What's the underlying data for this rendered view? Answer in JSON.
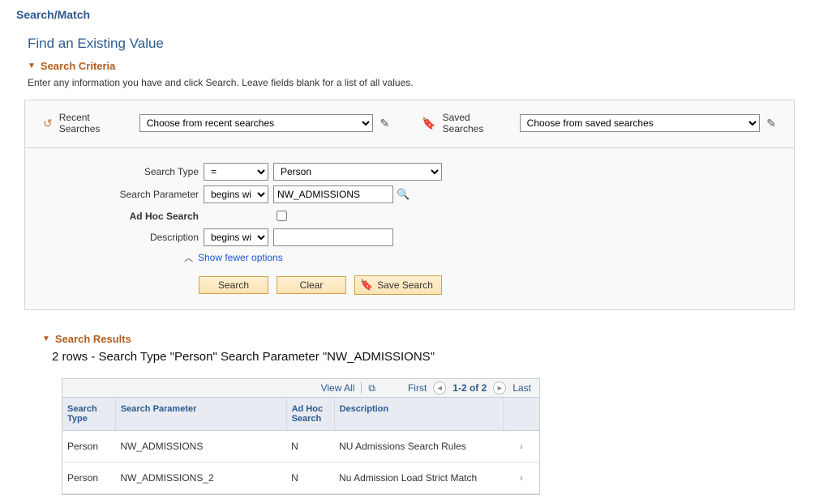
{
  "page_title": "Search/Match",
  "find_title": "Find an Existing Value",
  "criteria_label": "Search Criteria",
  "instructions": "Enter any information you have and click Search. Leave fields blank for a list of all values.",
  "recent": {
    "label": "Recent Searches",
    "placeholder": "Choose from recent searches"
  },
  "saved": {
    "label": "Saved Searches",
    "placeholder": "Choose from saved searches"
  },
  "fields": {
    "search_type": {
      "label": "Search Type",
      "op": "=",
      "value": "Person"
    },
    "search_parameter": {
      "label": "Search Parameter",
      "op": "begins with",
      "value": "NW_ADMISSIONS"
    },
    "adhoc": {
      "label": "Ad Hoc Search",
      "checked": false
    },
    "description": {
      "label": "Description",
      "op": "begins with",
      "value": ""
    }
  },
  "show_fewer": "Show fewer options",
  "buttons": {
    "search": "Search",
    "clear": "Clear",
    "save_search": "Save Search"
  },
  "results_label": "Search Results",
  "results_summary": "2 rows   -   Search Type \"Person\"   Search Parameter \"NW_ADMISSIONS\"",
  "grid": {
    "view_all": "View All",
    "first": "First",
    "range": "1-2 of 2",
    "last": "Last",
    "headers": {
      "search_type": "Search Type",
      "search_parameter": "Search Parameter",
      "adhoc": "Ad Hoc Search",
      "description": "Description"
    },
    "rows": [
      {
        "type": "Person",
        "param": "NW_ADMISSIONS",
        "adhoc": "N",
        "desc": "NU Admissions Search Rules"
      },
      {
        "type": "Person",
        "param": "NW_ADMISSIONS_2",
        "adhoc": "N",
        "desc": "Nu Admission Load Strict Match"
      }
    ]
  }
}
